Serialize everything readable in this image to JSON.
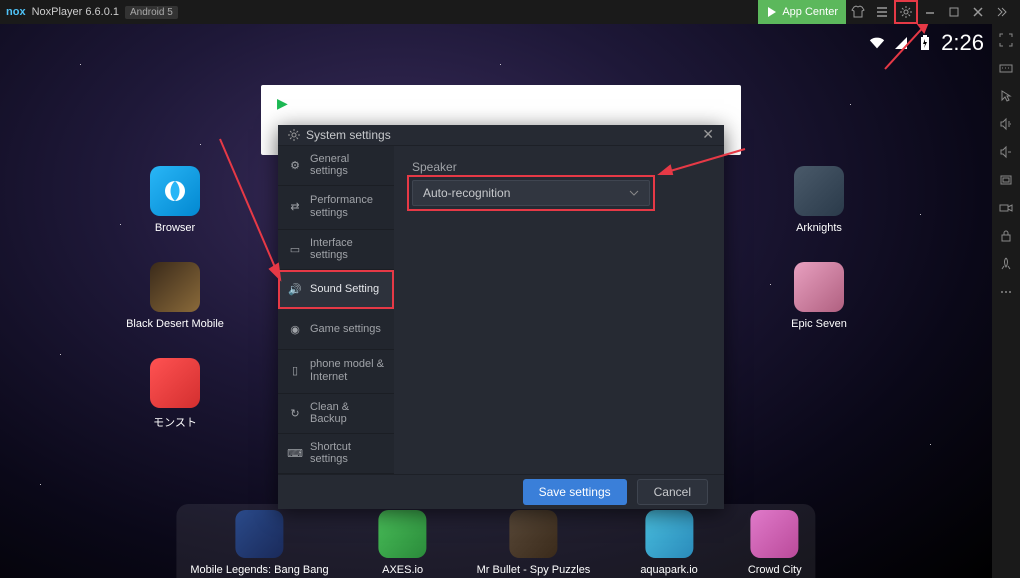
{
  "titlebar": {
    "logo": "nox",
    "title": "NoxPlayer 6.6.0.1",
    "android_badge": "Android 5",
    "app_center": "App Center"
  },
  "status_bar": {
    "time": "2:26"
  },
  "desktop_icons": {
    "browser": "Browser",
    "black_desert": "Black Desert Mobile",
    "monst": "モンスト",
    "arknights": "Arknights",
    "epic_seven": "Epic Seven"
  },
  "dock": {
    "mobile_legends": "Mobile Legends: Bang Bang",
    "axes": "AXES.io",
    "mr_bullet": "Mr Bullet - Spy Puzzles",
    "aquapark": "aquapark.io",
    "crowd_city": "Crowd City"
  },
  "modal": {
    "title": "System settings",
    "sidebar": {
      "general": "General settings",
      "performance": "Performance settings",
      "interface": "Interface settings",
      "sound": "Sound Setting",
      "game": "Game settings",
      "phone": "phone model & Internet",
      "clean": "Clean & Backup",
      "shortcut": "Shortcut settings"
    },
    "content": {
      "speaker_label": "Speaker",
      "speaker_value": "Auto-recognition"
    },
    "footer": {
      "save": "Save settings",
      "cancel": "Cancel"
    }
  }
}
